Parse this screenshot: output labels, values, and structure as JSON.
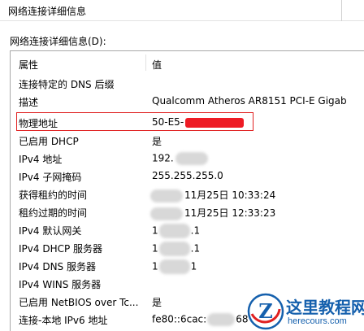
{
  "window": {
    "title": "网络连接详细信息"
  },
  "section_label": "网络连接详细信息(D):",
  "table": {
    "col_property": "属性",
    "col_value": "值",
    "rows": [
      {
        "prop": "连接特定的 DNS 后缀",
        "val": ""
      },
      {
        "prop": "描述",
        "val": "Qualcomm Atheros AR8151 PCI-E Gigab"
      },
      {
        "prop": "物理地址",
        "val": "50-E5-"
      },
      {
        "prop": "已启用 DHCP",
        "val": "是"
      },
      {
        "prop": "IPv4 地址",
        "val": "192."
      },
      {
        "prop": "IPv4 子网掩码",
        "val": "255.255.255.0"
      },
      {
        "prop": "获得租约的时间",
        "val": "11月25日 10:33:24"
      },
      {
        "prop": "租约过期的时间",
        "val": "11月25日 12:33:23"
      },
      {
        "prop": "IPv4 默认网关",
        "val_a": "1",
        "val_b": ".1"
      },
      {
        "prop": "IPv4 DHCP 服务器",
        "val_a": "1",
        "val_b": ".1"
      },
      {
        "prop": "IPv4 DNS 服务器",
        "val_a": "1",
        "val_b": "1"
      },
      {
        "prop": "IPv4 WINS 服务器",
        "val": ""
      },
      {
        "prop": "已启用 NetBIOS over Tc...",
        "val": "是"
      },
      {
        "prop": "连接-本地 IPv6 地址",
        "val_a": "fe80::6cac:",
        "val_b": "68"
      }
    ]
  },
  "colors": {
    "highlight_border": "#e02020",
    "redaction": "#ee1c25",
    "watermark_blue": "#1560ad"
  },
  "watermark": {
    "name": "这里教程网",
    "url": "herecours.com",
    "icon": "z-logo-icon"
  }
}
